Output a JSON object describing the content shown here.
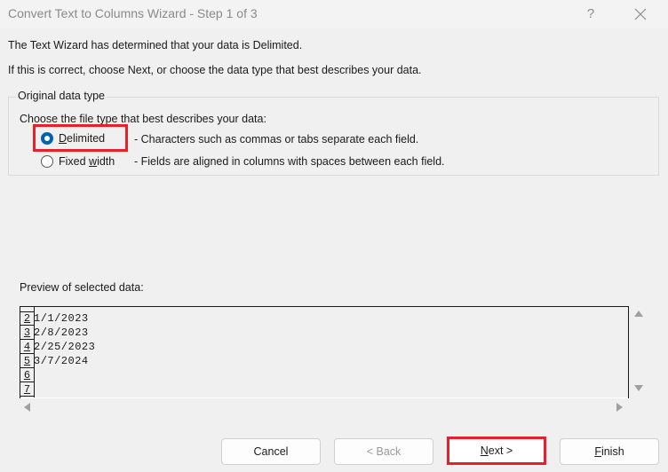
{
  "window": {
    "title": "Convert Text to Columns Wizard - Step 1 of 3",
    "help_label": "?",
    "close_icon": "close-icon"
  },
  "intro": {
    "line1": "The Text Wizard has determined that your data is Delimited.",
    "line2": "If this is correct, choose Next, or choose the data type that best describes your data."
  },
  "original_data_type": {
    "legend": "Original data type",
    "prompt": "Choose the file type that best describes your data:",
    "options": [
      {
        "label_prefix": "",
        "label_access_key": "D",
        "label_suffix": "elimited",
        "description": "- Characters such as commas or tabs separate each field.",
        "checked": true
      },
      {
        "label_prefix": "Fixed ",
        "label_access_key": "w",
        "label_suffix": "idth",
        "description": "- Fields are aligned in columns with spaces between each field.",
        "checked": false
      }
    ]
  },
  "preview": {
    "label": "Preview of selected data:",
    "rows": [
      {
        "num": "2",
        "value": "1/1/2023"
      },
      {
        "num": "3",
        "value": "2/8/2023"
      },
      {
        "num": "4",
        "value": "2/25/2023"
      },
      {
        "num": "5",
        "value": "3/7/2024"
      },
      {
        "num": "6",
        "value": ""
      },
      {
        "num": "7",
        "value": ""
      }
    ]
  },
  "buttons": {
    "cancel": "Cancel",
    "back": "< Back",
    "next_access_key": "N",
    "next_rest": "ext >",
    "finish_access_key": "F",
    "finish_rest": "inish"
  },
  "highlight_color": "#e8202a",
  "accent_color": "#0063b1"
}
